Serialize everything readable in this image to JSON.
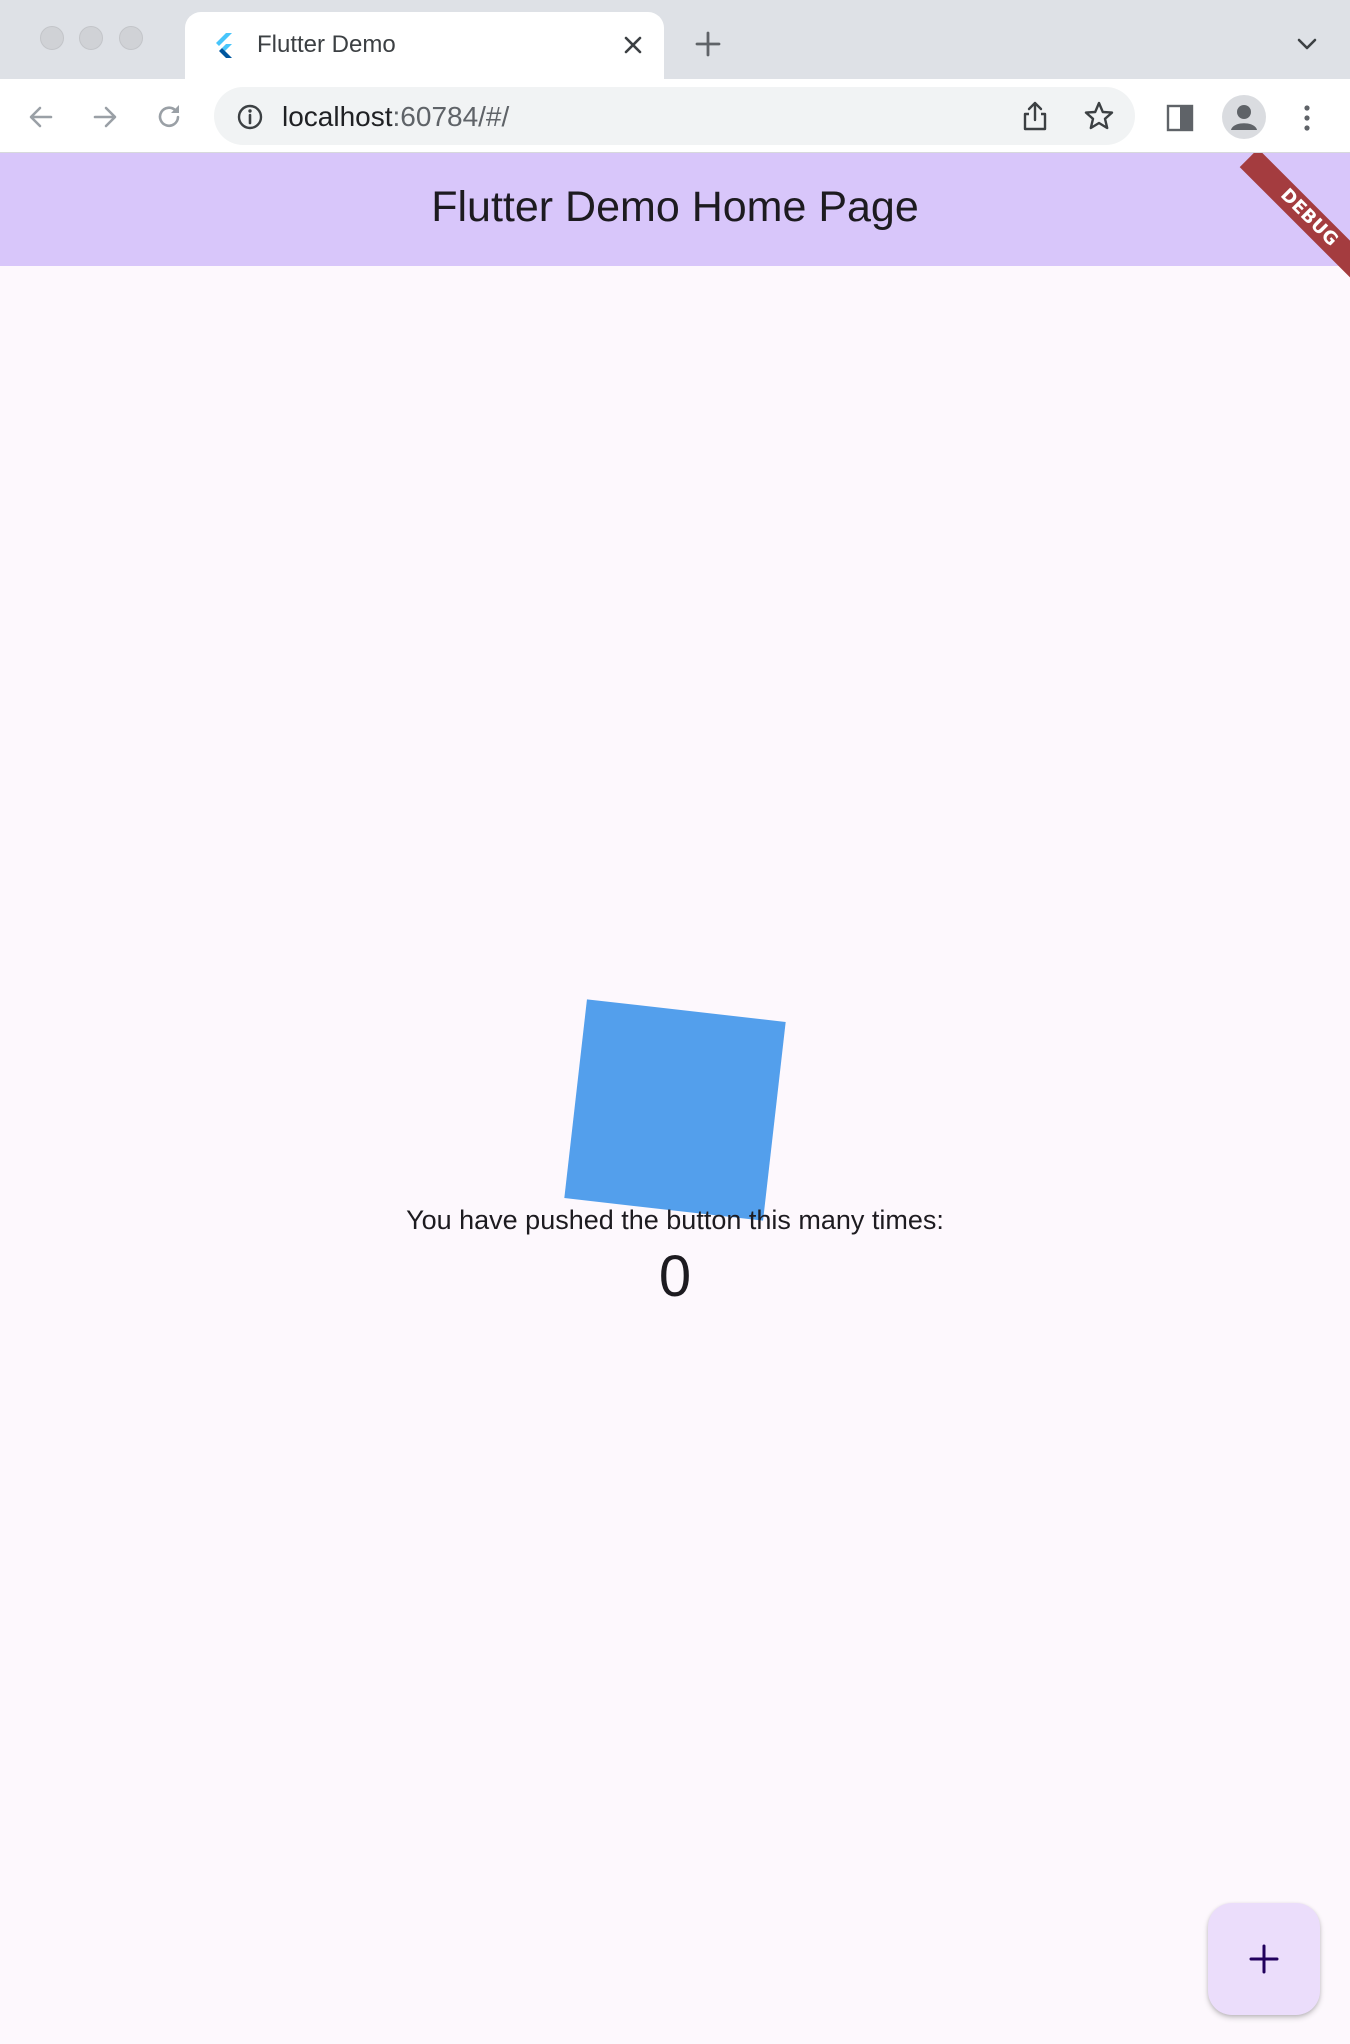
{
  "browser": {
    "tab": {
      "title": "Flutter Demo",
      "favicon": "flutter-logo-icon"
    },
    "address": {
      "host": "localhost",
      "rest": ":60784/#/"
    },
    "icons": [
      "back-arrow-icon",
      "forward-arrow-icon",
      "reload-icon",
      "info-icon",
      "share-icon",
      "star-icon",
      "side-panel-icon",
      "profile-icon",
      "menu-dots-icon",
      "close-icon",
      "plus-icon",
      "chevron-down-icon"
    ]
  },
  "app": {
    "appbar_title": "Flutter Demo Home Page",
    "debug_banner": "DEBUG",
    "counter_label": "You have pushed the button this many times:",
    "counter_value": "0",
    "fab_icon": "add-icon",
    "colors": {
      "appbar": "#d8c6fa",
      "background": "#fdf8fd",
      "square": "#539fec",
      "fab": "#ebddfb",
      "debug_banner": "#a43c3f"
    }
  }
}
